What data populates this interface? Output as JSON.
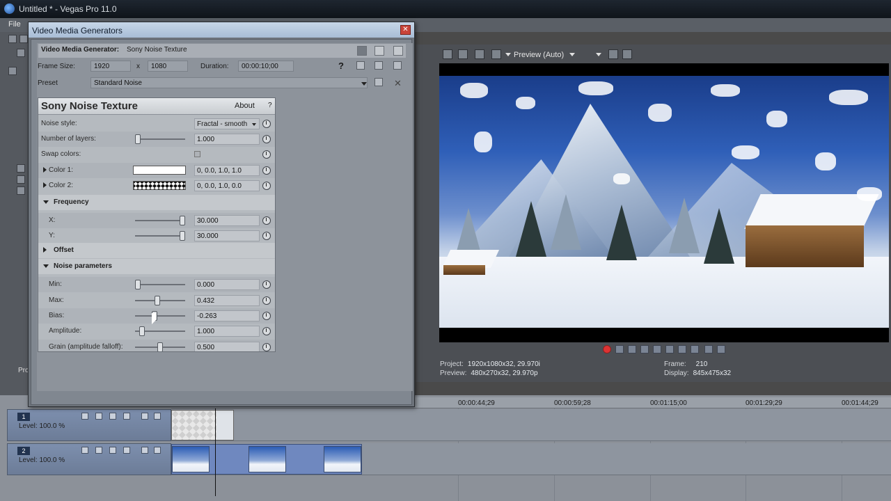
{
  "app": {
    "title": "Untitled * - Vegas Pro 11.0",
    "menu_file": "File"
  },
  "preview": {
    "mode_label": "Preview (Auto)",
    "project_label": "Project:",
    "project_value": "1920x1080x32, 29.970i",
    "preview_label": "Preview:",
    "preview_value": "480x270x32, 29.970p",
    "frame_label": "Frame:",
    "frame_value": "210",
    "display_label": "Display:",
    "display_value": "845x475x32"
  },
  "timeline": {
    "ticks": [
      "00:00:44;29",
      "00:00:59;28",
      "00:01:15;00",
      "00:01:29;29",
      "00:01:44;29"
    ],
    "track1": {
      "number": "1",
      "level": "Level: 100.0 %"
    },
    "track2": {
      "number": "2",
      "level": "Level: 100.0 %"
    },
    "side_label": "Pro"
  },
  "dialog": {
    "title": "Video Media Generators",
    "close_glyph": "✕",
    "generator_label": "Video Media Generator:",
    "generator_value": "Sony Noise Texture",
    "frame_size_label": "Frame Size:",
    "frame_w": "1920",
    "x_label": "x",
    "frame_h": "1080",
    "duration_label": "Duration:",
    "duration_value": "00:00:10;00",
    "help_glyph": "?",
    "preset_label": "Preset",
    "preset_value": "Standard Noise"
  },
  "plugin": {
    "name": "Sony Noise Texture",
    "about": "About",
    "help": "?",
    "noise_style_label": "Noise style:",
    "noise_style_value": "Fractal - smooth",
    "layers_label": "Number of layers:",
    "layers_value": "1.000",
    "layers_level": 0.0,
    "swap_label": "Swap colors:",
    "color1_label": "Color 1:",
    "color1_value": "0, 0.0, 1.0, 1.0",
    "color2_label": "Color 2:",
    "color2_value": "0, 0.0, 1.0, 0.0",
    "frequency_label": "Frequency",
    "x_label": "X:",
    "x_value": "30.000",
    "x_level": 1.0,
    "y_label": "Y:",
    "y_value": "30.000",
    "y_level": 1.0,
    "offset_label": "Offset",
    "noise_params_label": "Noise parameters",
    "min_label": "Min:",
    "min_value": "0.000",
    "min_level": 0.0,
    "max_label": "Max:",
    "max_value": "0.432",
    "max_level": 0.432,
    "bias_label": "Bias:",
    "bias_value": "-0.263",
    "bias_level": 0.37,
    "amplitude_label": "Amplitude:",
    "amplitude_value": "1.000",
    "amplitude_level": 0.1,
    "grain_label": "Grain (amplitude falloff):",
    "grain_value": "0.500",
    "grain_level": 0.5
  }
}
